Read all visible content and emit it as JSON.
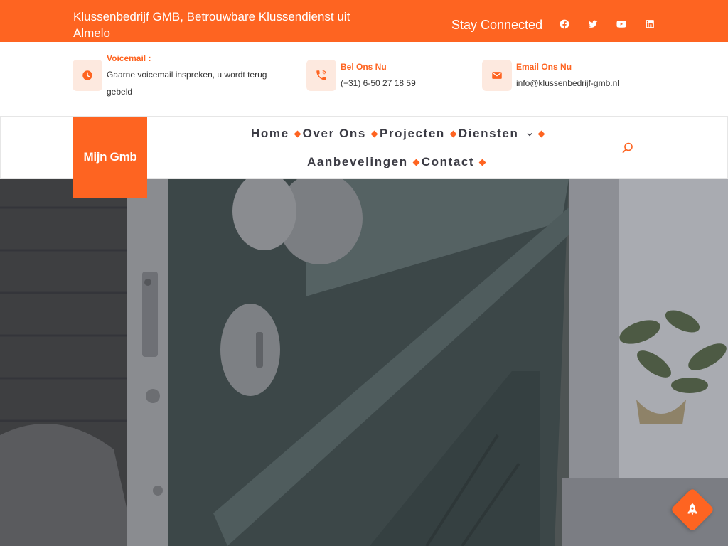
{
  "topbar": {
    "title": "Klussenbedrijf GMB, Betrouwbare Klussendienst uit Almelo",
    "stay_connected": "Stay Connected",
    "social": [
      "facebook-icon",
      "twitter-icon",
      "youtube-icon",
      "linkedin-icon"
    ]
  },
  "info": {
    "voicemail_label": "Voicemail :",
    "voicemail_text": "Gaarne voicemail inspreken, u wordt terug gebeld",
    "call_label": "Bel Ons Nu",
    "call_text": "(+31) 6-50 27 18 59",
    "email_label": "Email Ons Nu",
    "email_text": "info@klussenbedrijf-gmb.nl"
  },
  "logo": {
    "text": "Mijn Gmb"
  },
  "nav": {
    "home": "Home",
    "about": "Over Ons",
    "projects": "Projecten",
    "services": "Diensten",
    "recommendations": "Aanbevelingen",
    "contact": "Contact"
  },
  "colors": {
    "accent": "#fe6421",
    "accent_light": "#fde9df",
    "nav_text": "#3b3b44"
  },
  "icons": {
    "search": "search-icon",
    "back_to_top": "rocket-icon"
  }
}
